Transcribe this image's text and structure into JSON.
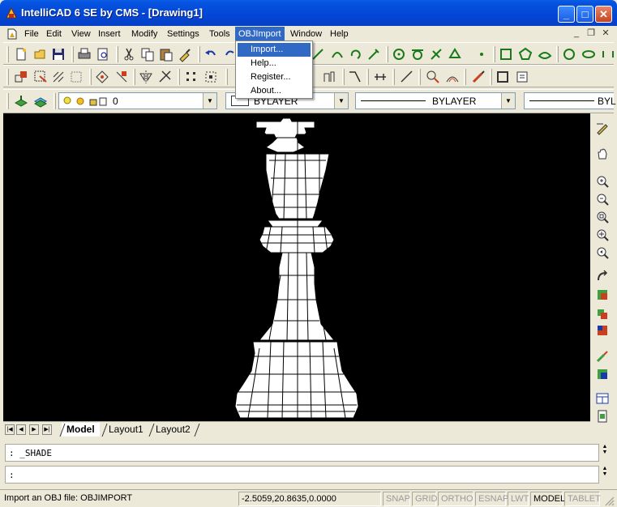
{
  "window": {
    "title": "IntelliCAD 6 SE by CMS - [Drawing1]",
    "controls": [
      "_",
      "□",
      "✕"
    ]
  },
  "menubar": {
    "items": [
      "File",
      "Edit",
      "View",
      "Insert",
      "Modify",
      "Settings",
      "Tools",
      "OBJImport",
      "Window",
      "Help"
    ],
    "active": "OBJImport",
    "mdi_controls": [
      "_",
      "❐",
      "✕"
    ]
  },
  "dropdown": {
    "items": [
      "Import...",
      "Help...",
      "Register...",
      "About..."
    ],
    "highlighted": "Import..."
  },
  "properties": {
    "layer": "0",
    "color": "BYLAYER",
    "linetype": "BYLAYER",
    "lineweight": "BYL"
  },
  "layout_tabs": [
    "Model",
    "Layout1",
    "Layout2"
  ],
  "active_tab": "Model",
  "command_history": ": _SHADE",
  "command_prompt": ":",
  "status": {
    "message": "Import an OBJ file: OBJIMPORT",
    "coordinates": "-2.5059,20.8635,0.0000",
    "toggles": [
      {
        "label": "SNAP",
        "on": false
      },
      {
        "label": "GRID",
        "on": false
      },
      {
        "label": "ORTHO",
        "on": false
      },
      {
        "label": "ESNAP",
        "on": false
      },
      {
        "label": "LWT",
        "on": false
      },
      {
        "label": "MODEL",
        "on": true
      },
      {
        "label": "TABLET",
        "on": false
      }
    ]
  },
  "colors": {
    "title_bar": "#0553e0",
    "menu_highlight": "#316ac5",
    "canvas": "#000000",
    "model": "#ffffff"
  }
}
